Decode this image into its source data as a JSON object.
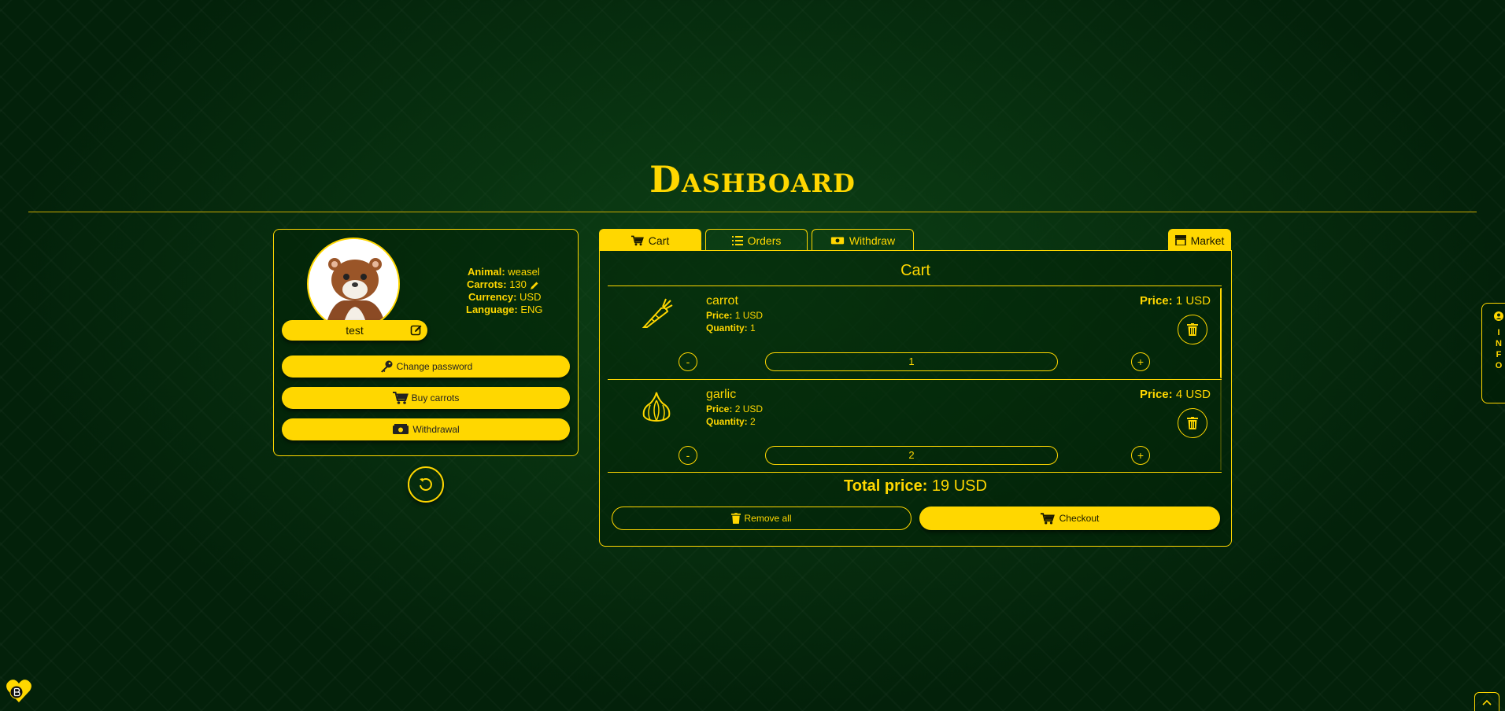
{
  "page": {
    "title": "Dashboard"
  },
  "profile": {
    "username": "test",
    "info": [
      {
        "label": "Animal:",
        "value": "weasel"
      },
      {
        "label": "Carrots:",
        "value": "130"
      },
      {
        "label": "Currency:",
        "value": "USD"
      },
      {
        "label": "Language:",
        "value": "ENG"
      }
    ],
    "buttons": {
      "change_password": "Change password",
      "buy_carrots": "Buy carrots",
      "withdrawal": "Withdrawal"
    }
  },
  "tabs": {
    "cart": "Cart",
    "orders": "Orders",
    "withdraw": "Withdraw",
    "market": "Market"
  },
  "cart": {
    "title": "Cart",
    "items": [
      {
        "name": "carrot",
        "price_label": "Price:",
        "price": "1 USD",
        "quantity_label": "Quantity:",
        "quantity": "1",
        "total_label": "Price:",
        "total": "1 USD",
        "minus": "-",
        "plus": "+",
        "input_value": "1",
        "icon": "carrot-icon"
      },
      {
        "name": "garlic",
        "price_label": "Price:",
        "price": "2 USD",
        "quantity_label": "Quantity:",
        "quantity": "2",
        "total_label": "Price:",
        "total": "4 USD",
        "minus": "-",
        "plus": "+",
        "input_value": "2",
        "icon": "garlic-icon"
      }
    ],
    "total_label": "Total price:",
    "total_value": "19 USD",
    "remove_all": "Remove all",
    "checkout": "Checkout"
  },
  "side_tab": {
    "letters": [
      "I",
      "N",
      "F",
      "O"
    ]
  },
  "colors": {
    "accent": "#ffd700",
    "background": "#03210a"
  }
}
